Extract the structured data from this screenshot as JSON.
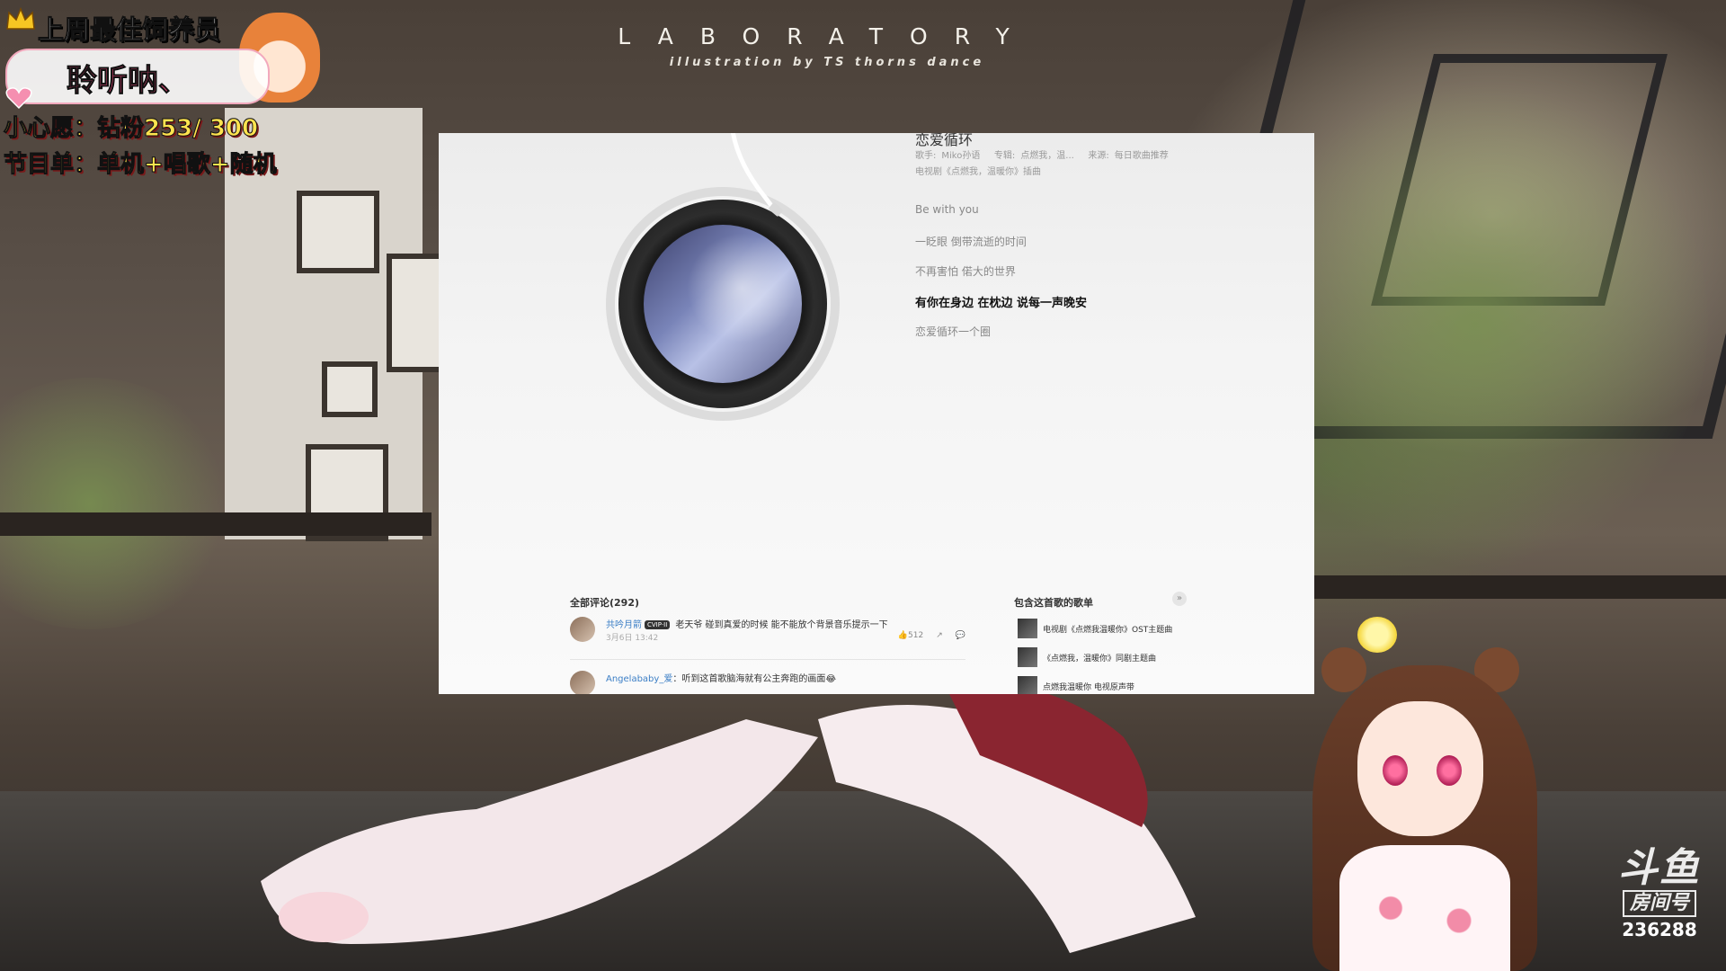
{
  "overlay": {
    "best_feeder_label": "上周最佳饲养员",
    "best_feeder_name": "聆听呐、",
    "wish": "小心愿：钻粉253/ 300",
    "program": "节目单：单机+唱歌+随机"
  },
  "wallpaper": {
    "title": "LABORATORY",
    "subtitle": "illustration by TS thorns dance"
  },
  "player": {
    "song_title": "恋爱循环",
    "meta_line1": {
      "singer_label": "歌手:",
      "singer": "Miko孙语",
      "album_label": "专辑:",
      "album": "点燃我，温...",
      "source_label": "来源:",
      "source": "每日歌曲推荐"
    },
    "meta_line2": "电视剧《点燃我，温暖你》插曲",
    "lyrics": [
      {
        "text": "Be with you",
        "active": false
      },
      {
        "text": "一眨眼 倒带流逝的时间",
        "active": false
      },
      {
        "text": "不再害怕 偌大的世界",
        "active": false
      },
      {
        "text": "有你在身边 在枕边 说每一声晚安",
        "active": true
      },
      {
        "text": "恋爱循环一个圈",
        "active": false
      }
    ],
    "comments_title": "全部评论(292)",
    "comments": [
      {
        "user": "共吟月箭",
        "badge": "CVIP·II",
        "text": "老天爷 碰到真爱的时候 能不能放个背景音乐提示一下",
        "time": "3月6日 13:42",
        "likes": "512"
      },
      {
        "user": "Angelababy_爱",
        "text": "：听到这首歌脑海就有公主奔跑的画面😂"
      }
    ],
    "playlists_title": "包含这首歌的歌单",
    "playlists": [
      {
        "name": "电视剧《点燃我温暖你》OST主题曲"
      },
      {
        "name": "《点燃我，温暖你》同剧主题曲"
      },
      {
        "name": "点燃我温暖你 电视原声带"
      }
    ]
  },
  "douyu": {
    "logo": "斗鱼",
    "room_label": "房间号",
    "room_number": "236288"
  },
  "colors": {
    "overlay_yellow": "#ffe34f",
    "overlay_pink": "#e84a7a",
    "link_blue": "#3c7fc6"
  }
}
